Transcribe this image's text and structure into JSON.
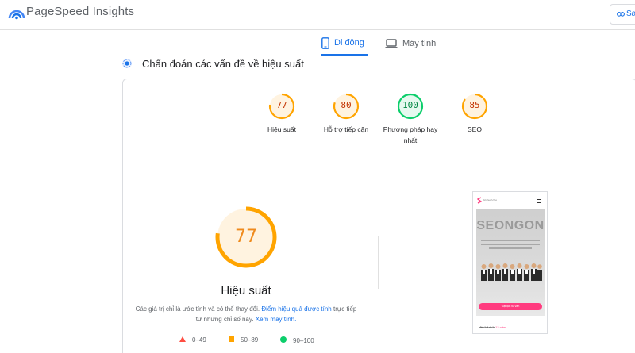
{
  "app": {
    "title": "PageSpeed Insights",
    "share_label": "Sa"
  },
  "tabs": [
    {
      "label": "Di động",
      "icon": "smartphone-icon",
      "active": true
    },
    {
      "label": "Máy tính",
      "icon": "laptop-icon",
      "active": false
    }
  ],
  "diagnostics": {
    "title": "Chẩn đoán các vấn đề về hiệu suất"
  },
  "scores": [
    {
      "value": "77",
      "label": "Hiệu suất",
      "color": "#ffa400",
      "text_color": "#c33300"
    },
    {
      "value": "80",
      "label": "Hỗ trợ tiếp cận",
      "color": "#ffa400",
      "text_color": "#c33300"
    },
    {
      "value": "100",
      "label_line1": "Phương pháp hay",
      "label_line2": "nhất",
      "color": "#0cce6b",
      "text_color": "#018642"
    },
    {
      "value": "85",
      "label": "SEO",
      "color": "#ffa400",
      "text_color": "#c33300"
    }
  ],
  "main_score": {
    "value": "77",
    "fraction": 0.77,
    "label": "Hiệu suất",
    "note_prefix": "Các giá trị chỉ là ước tính và có thể thay đổi. ",
    "note_link1": "Điểm hiệu quả được tính",
    "note_middle": " trực tiếp từ những chỉ số này. ",
    "note_link2": "Xem máy tính."
  },
  "legend": [
    {
      "range": "0–49",
      "shape": "triangle",
      "color": "#ff4e42"
    },
    {
      "range": "50–89",
      "shape": "square",
      "color": "#ffa400"
    },
    {
      "range": "90–100",
      "shape": "circle",
      "color": "#0cce6b"
    }
  ],
  "preview": {
    "headline": "SEONGON",
    "cta": "Đặt lịch tư vấn",
    "footer_prefix": "Hành trình ",
    "footer_highlight": "12 năm"
  },
  "colors": {
    "accent": "#1a73e8",
    "average": "#ffa400",
    "good": "#0cce6b",
    "poor": "#ff4e42"
  }
}
